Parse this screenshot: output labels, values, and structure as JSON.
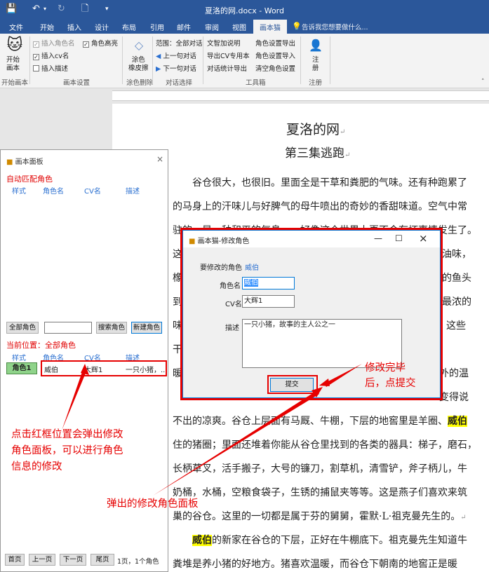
{
  "window": {
    "title": "夏洛的网.docx - Word"
  },
  "tabs": [
    "文件",
    "开始",
    "插入",
    "设计",
    "布局",
    "引用",
    "邮件",
    "审阅",
    "视图",
    "画本猫"
  ],
  "tell_me": "告诉我您想要做什么...",
  "ribbon": {
    "start_label": "开始\n画本",
    "insert_role_name": "插入角色名",
    "insert_cv_name": "插入cv名",
    "insert_desc": "插入描述",
    "role_highlight": "角色高亮",
    "erase_label": "涂色\n橡皮擦",
    "range": "范围：全部对话",
    "prev_dialog": "上一句对话",
    "next_dialog": "下一句对话",
    "add_doc_desc": "文智加说明",
    "export_cv": "导出CV专用本",
    "export_stats": "对话统计导出",
    "export_roles": "角色设置导出",
    "import_roles": "角色设置导入",
    "clear_roles": "清空角色设置",
    "register": "注\n册",
    "groups": [
      "开始画本",
      "画本设置",
      "涂色删除",
      "对话选择",
      "工具箱",
      "注册"
    ]
  },
  "document": {
    "title": "夏洛的网",
    "subtitle": "第三集逃跑",
    "lines": [
      "谷仓很大，也很旧。里面全是干草和粪肥的气味。还有种跑累了",
      "的马身上的汗味儿与好脾气的母牛喷出的奇妙的香甜味道。空气中常",
      "驻的，是一种和平的气息——好像这个世界上再不会有坏事情发生了。",
      "这",
      "橡",
      "到",
      "味",
      "干",
      "暖",
      "不出的凉爽。谷仓上层面有马厩、牛棚，下层的地窖里是羊圈、",
      "住的猪圈；里面还堆着你能从谷仓里找到的各类的器具：梯子，磨石，",
      "长柄草叉，活手搬子，大号的镰刀，割草机，清雪铲，斧子柄儿，牛",
      "奶桶，水桶，空粮食袋子，生锈的捕鼠夹等等。这是燕子们喜欢来筑",
      "巢的谷仓。这里的一切都是属于芬的舅舅，霍默·L·祖克曼先生的。",
      "的新家在谷仓的下层，正好在牛棚底下。祖克曼先生知道牛",
      "粪堆是养小猪的好地方。猪喜欢温暖，而谷仓下朝南的地窖正是暖"
    ],
    "right_frags": [
      "油味，",
      "的鱼头",
      "最浓的",
      "。这些",
      "外的温",
      "变得说"
    ],
    "highlight_name": "威伯"
  },
  "panel": {
    "title": "画本面板",
    "auto_match": "自动匹配角色",
    "cols": [
      "样式",
      "角色名",
      "CV名",
      "描述"
    ],
    "all_roles_btn": "全部角色",
    "search_btn": "搜索角色",
    "new_role_btn": "新建角色",
    "position": "当前位置：全部角色",
    "row": {
      "style": "角色1",
      "name": "威伯",
      "cv": "大辉1",
      "desc": "一只小猪，.."
    },
    "first": "首页",
    "prev": "上一页",
    "next": "下一页",
    "last": "尾页",
    "page_info": "1页，1个角色"
  },
  "dialog": {
    "title": "画本猫-修改角色",
    "modify_label": "要修改的角色",
    "modify_value": "威伯",
    "name_label": "角色名",
    "name_value": "威伯",
    "cv_label": "CV名",
    "cv_value": "大辉1",
    "desc_label": "描述",
    "desc_value": "一只小猪，故事的主人公之一",
    "submit": "提交"
  },
  "annotations": {
    "right": "修改完毕\n后，点提交",
    "left": "点击红框位置会弹出修改\n角色面板，可以进行角色\n信息的修改",
    "bottom": "弹出的修改角色面板"
  },
  "colors": {
    "word_blue": "#2b579a",
    "annotation_red": "#e60000",
    "highlight": "#ffff00"
  }
}
